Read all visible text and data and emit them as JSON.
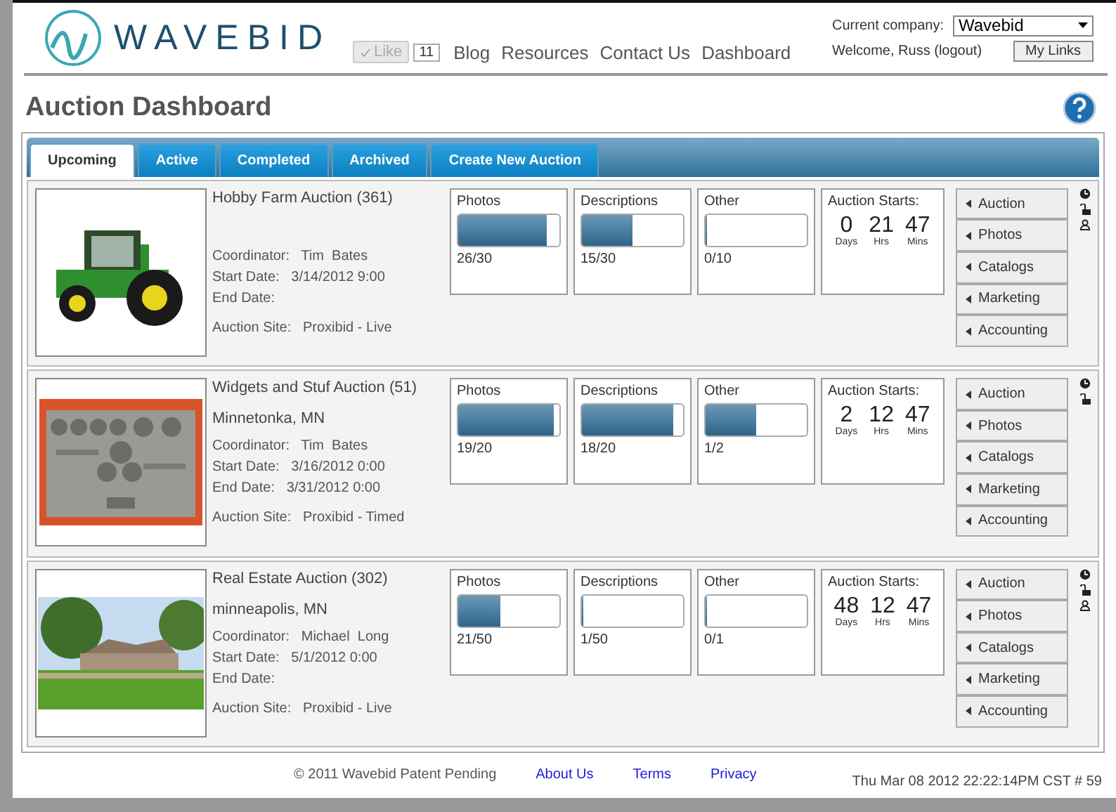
{
  "header": {
    "logo_text": "WAVEBID",
    "like": {
      "label": "Like",
      "count": "11"
    },
    "nav": [
      "Blog",
      "Resources",
      "Contact Us",
      "Dashboard"
    ],
    "company": {
      "label": "Current company:",
      "value": "Wavebid"
    },
    "welcome": "Welcome, Russ (logout)",
    "my_links": "My Links"
  },
  "page_title": "Auction Dashboard",
  "tabs": [
    {
      "label": "Upcoming",
      "selected": true
    },
    {
      "label": "Active",
      "selected": false
    },
    {
      "label": "Completed",
      "selected": false
    },
    {
      "label": "Archived",
      "selected": false
    },
    {
      "label": "Create New Auction",
      "selected": false
    }
  ],
  "auctions": [
    {
      "title": "Hobby Farm Auction (361)",
      "details": [
        {
          "label": "Coordinator:",
          "value": "Tim  Bates"
        },
        {
          "label": "Start Date:",
          "value": "3/14/2012 9:00"
        },
        {
          "label": "End Date:"
        }
      ],
      "site": {
        "label": "Auction Site:",
        "value": "Proxibid - Live"
      },
      "progress": [
        {
          "label": "Photos",
          "level": 0.87,
          "reading": "26/30"
        },
        {
          "label": "Descriptions",
          "level": 0.5,
          "reading": "15/30"
        },
        {
          "label": "Other",
          "level": 0,
          "reading": "0/10"
        }
      ],
      "countdown": {
        "title": "Auction Starts:",
        "units": [
          {
            "value": "0",
            "label": "Days"
          },
          {
            "value": "21",
            "label": "Hrs"
          },
          {
            "value": "47",
            "label": "Mins"
          }
        ]
      },
      "menu": [
        "Auction",
        "Photos",
        "Catalogs",
        "Marketing",
        "Accounting"
      ],
      "status_icons": [
        {
          "kind": "clock"
        },
        {
          "kind": "lock"
        },
        {
          "kind": "person"
        }
      ]
    },
    {
      "title": "Widgets and Stuf Auction (51)",
      "location": "Minnetonka, MN",
      "details": [
        {
          "label": "Coordinator:",
          "value": "Tim  Bates"
        },
        {
          "label": "Start Date:",
          "value": "3/16/2012 0:00"
        },
        {
          "label": "End Date:",
          "value": "3/31/2012 0:00"
        }
      ],
      "site": {
        "label": "Auction Site:",
        "value": "Proxibid - Timed"
      },
      "progress": [
        {
          "label": "Photos",
          "level": 0.95,
          "reading": "19/20"
        },
        {
          "label": "Descriptions",
          "level": 0.9,
          "reading": "18/20"
        },
        {
          "label": "Other",
          "level": 0.5,
          "reading": "1/2"
        }
      ],
      "countdown": {
        "title": "Auction Starts:",
        "units": [
          {
            "value": "2",
            "label": "Days"
          },
          {
            "value": "12",
            "label": "Hrs"
          },
          {
            "value": "47",
            "label": "Mins"
          }
        ]
      },
      "menu": [
        "Auction",
        "Photos",
        "Catalogs",
        "Marketing",
        "Accounting"
      ],
      "status_icons": [
        {
          "kind": "clock"
        },
        {
          "kind": "lock"
        }
      ]
    },
    {
      "title": "Real Estate Auction (302)",
      "location": "minneapolis, MN",
      "details": [
        {
          "label": "Coordinator:",
          "value": "Michael  Long"
        },
        {
          "label": "Start Date:",
          "value": "5/1/2012 0:00"
        },
        {
          "label": "End Date:"
        }
      ],
      "site": {
        "label": "Auction Site:",
        "value": "Proxibid - Live"
      },
      "progress": [
        {
          "label": "Photos",
          "level": 0.42,
          "reading": "21/50"
        },
        {
          "label": "Descriptions",
          "level": 0.02,
          "reading": "1/50"
        },
        {
          "label": "Other",
          "level": 0,
          "reading": "0/1"
        }
      ],
      "countdown": {
        "title": "Auction Starts:",
        "units": [
          {
            "value": "48",
            "label": "Days"
          },
          {
            "value": "12",
            "label": "Hrs"
          },
          {
            "value": "47",
            "label": "Mins"
          }
        ]
      },
      "menu": [
        "Auction",
        "Photos",
        "Catalogs",
        "Marketing",
        "Accounting"
      ],
      "status_icons": [
        {
          "kind": "clock"
        },
        {
          "kind": "lock"
        },
        {
          "kind": "person"
        }
      ]
    }
  ],
  "footer": {
    "copyright": "© 2011 Wavebid Patent Pending",
    "links": [
      "About Us",
      "Terms",
      "Privacy"
    ],
    "timestamp": "Thu Mar 08 2012 22:22:14PM CST",
    "page_number": "# 59"
  }
}
